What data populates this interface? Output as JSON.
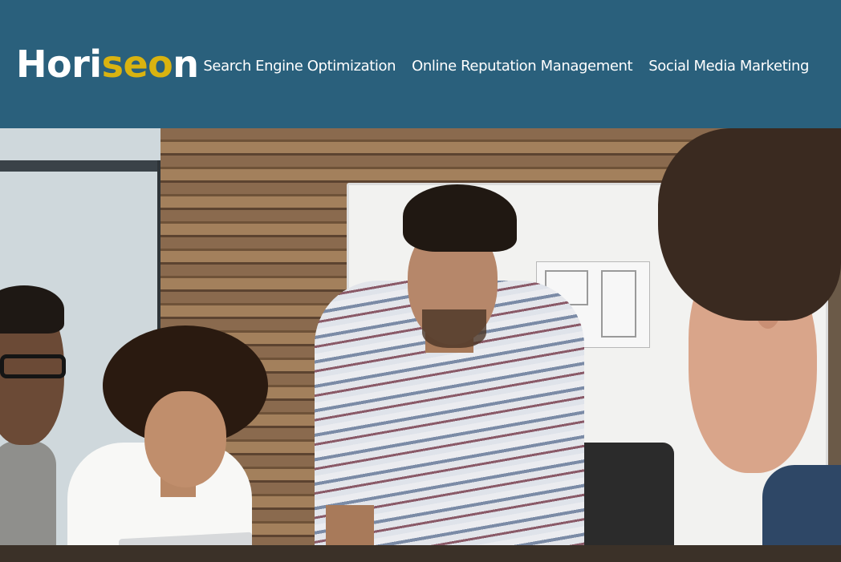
{
  "header": {
    "logo": {
      "part1": "Hori",
      "accent": "seo",
      "part2": "n"
    },
    "nav": [
      {
        "label": "Search Engine Optimization"
      },
      {
        "label": "Online Reputation Management"
      },
      {
        "label": "Social Media Marketing"
      }
    ]
  },
  "hero": {
    "description": "Hero photo: team of four gathered around a table in an office meeting room with a reclaimed wood wall and whiteboard"
  },
  "colors": {
    "header_bg": "#2a607c",
    "logo_text": "#ffffff",
    "logo_accent": "#d9b310",
    "nav_text": "#ffffff"
  }
}
